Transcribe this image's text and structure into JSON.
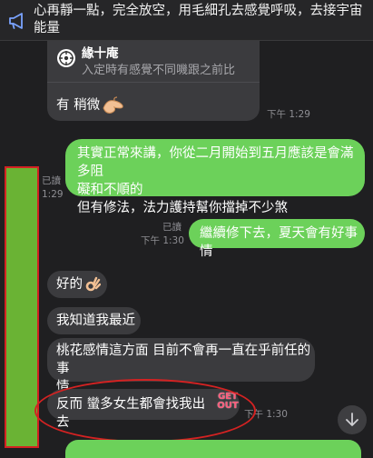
{
  "announcement": {
    "text": "心再靜一點，完全放空，用毛細孔去感覺呼吸，去接宇宙能量",
    "icon": "megaphone-icon"
  },
  "messages": [
    {
      "side": "left",
      "card": {
        "title": "緣十庵",
        "subtitle": "入定時有感覺不同嘰跟之前比"
      },
      "text": "有 稍微",
      "emoji": "pinch-hand",
      "time": "下午 1:29"
    },
    {
      "side": "right",
      "lines": [
        "其實正常來講，你從二月開始到五月應該是會滿多阻",
        "礙和不順的",
        "但有修法，法力護持幫你擋掉不少煞"
      ],
      "read": "已讀",
      "time": "1:29"
    },
    {
      "side": "right",
      "text": "繼續修下去，夏天會有好事情",
      "read": "已讀",
      "time": "下午 1:30"
    },
    {
      "side": "left",
      "text": "好的",
      "emoji": "ok-hand"
    },
    {
      "side": "left",
      "text": "我知道我最近"
    },
    {
      "side": "left",
      "lines": [
        "桃花感情這方面 目前不會再一直在乎前任的事",
        "情"
      ]
    },
    {
      "side": "left",
      "text": "反而 蠻多女生都會找我出去",
      "sticker": "GET OUT",
      "time": "下午 1:30"
    }
  ],
  "colors": {
    "accent_green": "#6cd15a",
    "bubble_gray": "#3b3b3e",
    "annotation_red": "#d42222"
  }
}
